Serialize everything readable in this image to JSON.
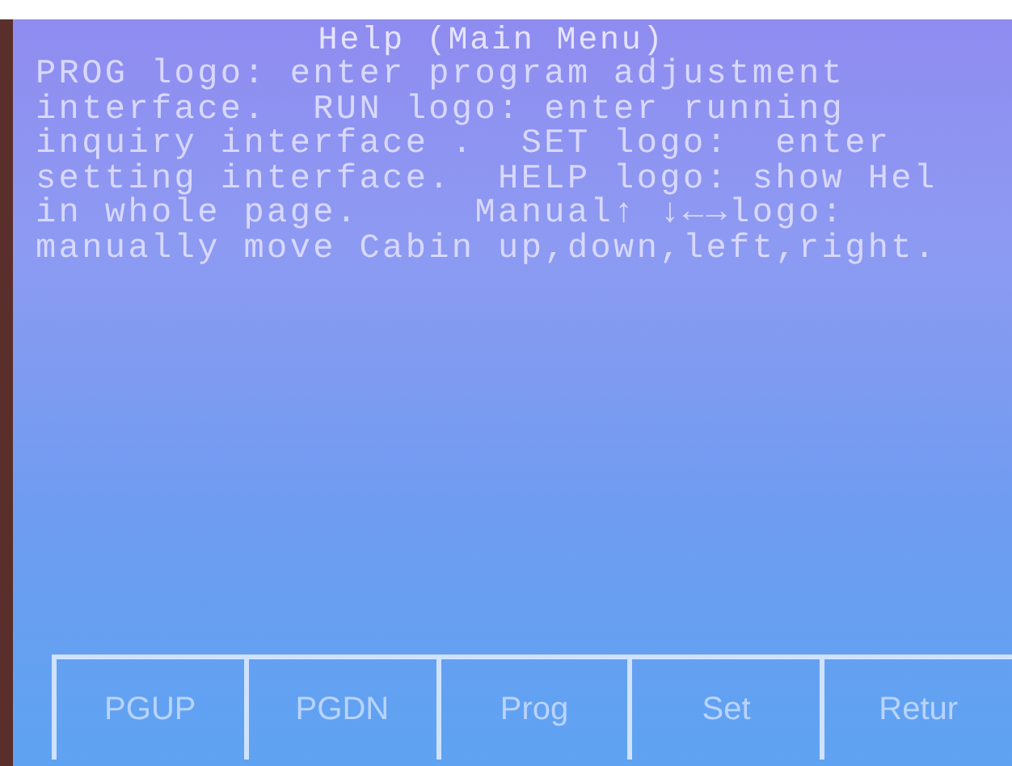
{
  "screen": {
    "title": "Help (Main Menu)",
    "lines": [
      "PROG logo: enter program adjustment",
      "interface.  RUN logo: enter running",
      "inquiry interface .  SET logo:  enter",
      "setting interface.  HELP logo: show Hel",
      "in whole page.     Manual↑ ↓←→logo:",
      "manually move Cabin up,down,left,right."
    ]
  },
  "buttons": [
    "PGUP",
    "PGDN",
    "Prog",
    "Set",
    "Retur"
  ]
}
